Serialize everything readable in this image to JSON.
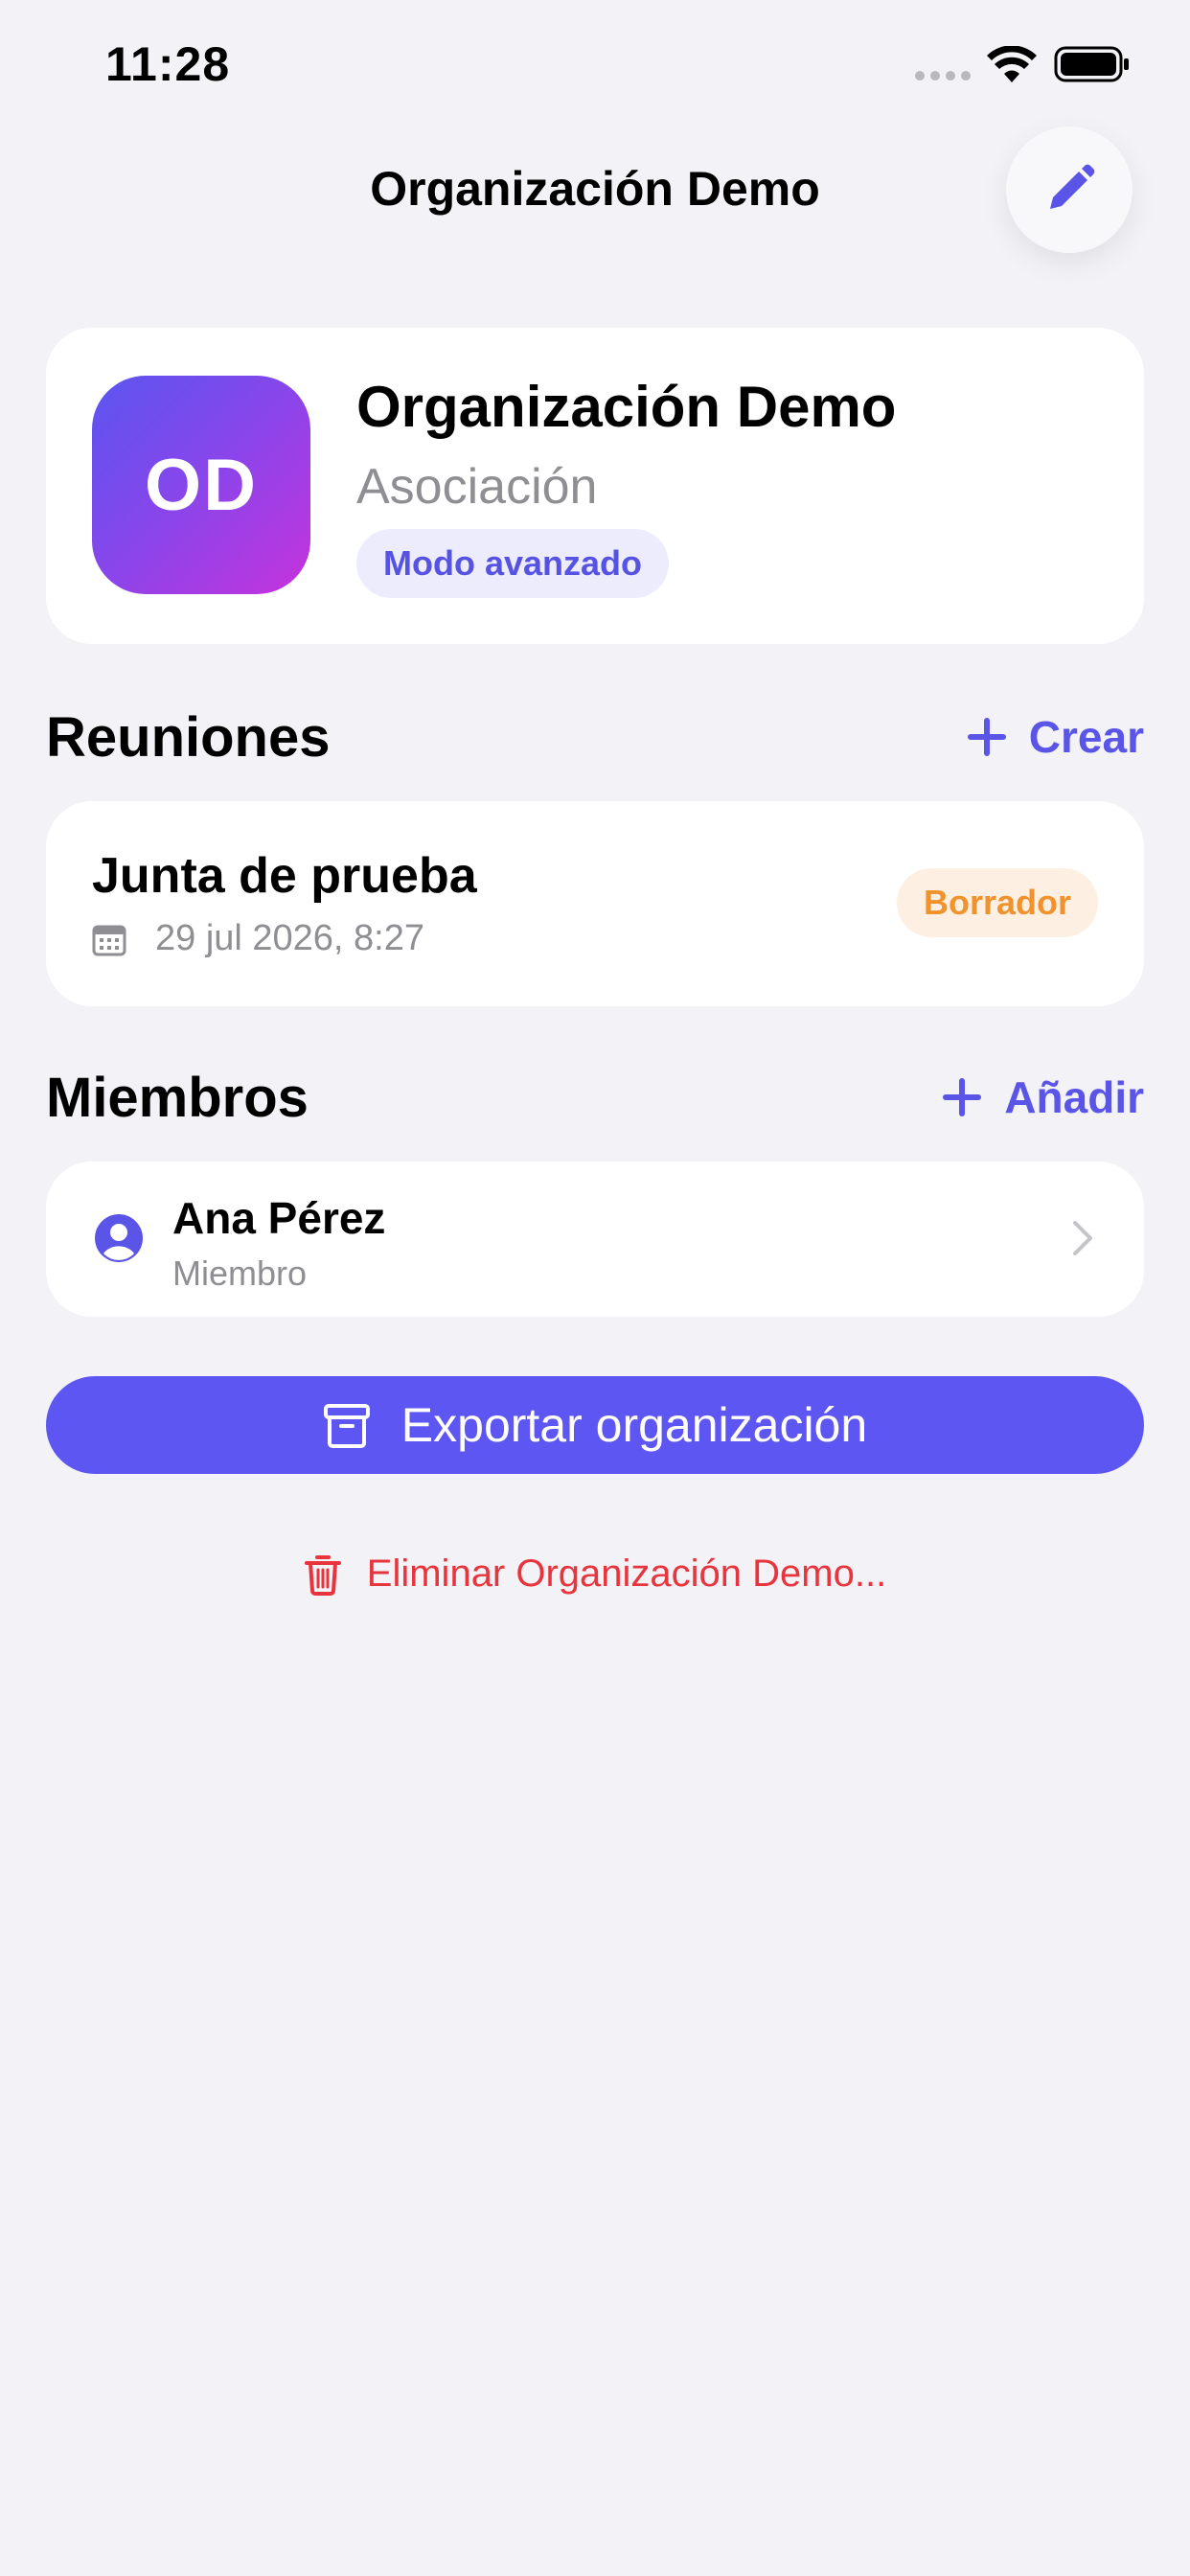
{
  "status_bar": {
    "time": "11:28"
  },
  "nav": {
    "title": "Organización Demo",
    "edit_icon": "pencil-icon"
  },
  "organization": {
    "initials": "OD",
    "name": "Organización Demo",
    "type": "Asociación",
    "mode_badge": "Modo avanzado"
  },
  "meetings": {
    "title": "Reuniones",
    "action_label": "Crear",
    "items": [
      {
        "title": "Junta de prueba",
        "datetime": "29 jul 2026, 8:27",
        "status": "Borrador"
      }
    ]
  },
  "members": {
    "title": "Miembros",
    "action_label": "Añadir",
    "items": [
      {
        "name": "Ana Pérez",
        "role": "Miembro"
      }
    ]
  },
  "export_button": {
    "label": "Exportar organización"
  },
  "delete_link": {
    "label": "Eliminar Organización Demo..."
  },
  "colors": {
    "accent": "#5e56f2",
    "danger": "#e8343c",
    "draft": "#f0922e",
    "background": "#f2f2f7"
  }
}
